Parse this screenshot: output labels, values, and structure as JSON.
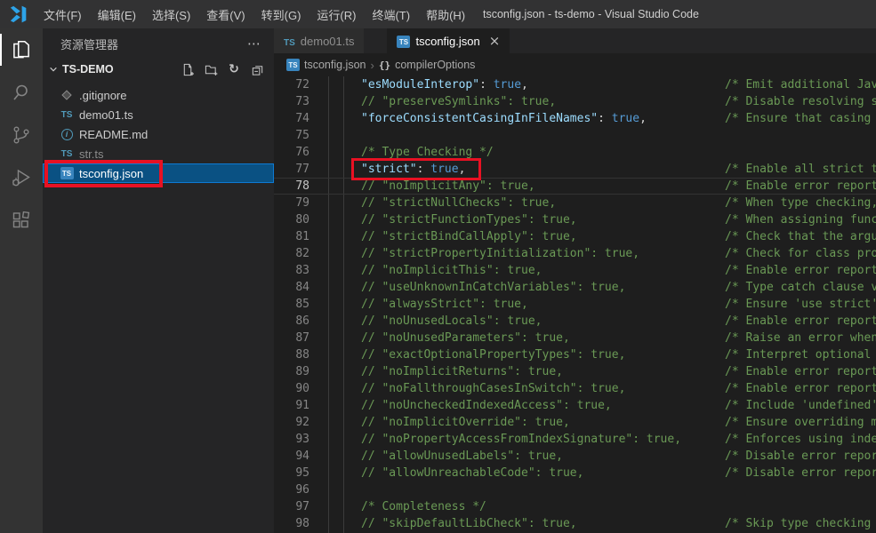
{
  "window_title": "tsconfig.json - ts-demo - Visual Studio Code",
  "menu_items": [
    "文件(F)",
    "编辑(E)",
    "选择(S)",
    "查看(V)",
    "转到(G)",
    "运行(R)",
    "终端(T)",
    "帮助(H)"
  ],
  "activity_bar": [
    {
      "id": "explorer",
      "active": true
    },
    {
      "id": "search",
      "active": false
    },
    {
      "id": "source-control",
      "active": false
    },
    {
      "id": "run-debug",
      "active": false
    },
    {
      "id": "extensions",
      "active": false
    }
  ],
  "sidebar": {
    "title": "资源管理器",
    "folder": "TS-DEMO",
    "actions": [
      "new-file",
      "new-folder",
      "refresh",
      "collapse-all"
    ],
    "files": [
      {
        "name": ".gitignore",
        "icon": "gitignore-icon",
        "dimmed": false,
        "selected": false,
        "annotated": false
      },
      {
        "name": "demo01.ts",
        "icon": "ts-icon",
        "dimmed": false,
        "selected": false,
        "annotated": false
      },
      {
        "name": "README.md",
        "icon": "info-icon",
        "dimmed": false,
        "selected": false,
        "annotated": false
      },
      {
        "name": "str.ts",
        "icon": "ts-icon",
        "dimmed": true,
        "selected": false,
        "annotated": false
      },
      {
        "name": "tsconfig.json",
        "icon": "ts-badge-icon",
        "dimmed": false,
        "selected": true,
        "annotated": true
      }
    ]
  },
  "tabs": [
    {
      "label": "demo01.ts",
      "icon": "ts-icon",
      "active": false,
      "closable": false
    },
    {
      "label": "tsconfig.json",
      "icon": "ts-badge-icon",
      "active": true,
      "closable": true
    }
  ],
  "breadcrumb": [
    {
      "icon": "ts-badge-icon",
      "label": "tsconfig.json"
    },
    {
      "icon": "braces-icon",
      "label": "compilerOptions"
    }
  ],
  "editor": {
    "language": "json-with-comments",
    "lines": [
      {
        "n": 72,
        "tokens": [
          [
            "key",
            "\"esModuleInterop\""
          ],
          [
            "punc",
            ": "
          ],
          [
            "bool",
            "true"
          ],
          [
            "punc",
            ","
          ]
        ],
        "comment": "/* Emit additional JavaScript to ease support for importing CommonJS modules. This enables 'allowSyntheticDefaultImports' for type compatibility. */",
        "annotated": false,
        "current": false
      },
      {
        "n": 73,
        "tokens": [
          [
            "comment",
            "// \"preserveSymlinks\": true,"
          ]
        ],
        "comment": "/* Disable resolving symlinks to their realpath. This correlates to the same flag in node. */",
        "annotated": false,
        "current": false
      },
      {
        "n": 74,
        "tokens": [
          [
            "key",
            "\"forceConsistentCasingInFileNames\""
          ],
          [
            "punc",
            ": "
          ],
          [
            "bool",
            "true"
          ],
          [
            "punc",
            ","
          ]
        ],
        "comment": "/* Ensure that casing is correct in imports. */",
        "annotated": false,
        "current": false
      },
      {
        "n": 75,
        "tokens": [],
        "comment": "",
        "annotated": false,
        "current": false
      },
      {
        "n": 76,
        "tokens": [
          [
            "comment",
            "/* Type Checking */"
          ]
        ],
        "comment": "",
        "annotated": false,
        "current": false
      },
      {
        "n": 77,
        "tokens": [
          [
            "key",
            "\"strict\""
          ],
          [
            "punc",
            ": "
          ],
          [
            "bool",
            "true"
          ],
          [
            "punc",
            ","
          ]
        ],
        "comment": "/* Enable all strict type-checking options. */",
        "annotated": true,
        "current": false
      },
      {
        "n": 78,
        "tokens": [
          [
            "comment",
            "// \"noImplicitAny\": true,"
          ]
        ],
        "comment": "/* Enable error reporting for expressions and declarations with an implied 'any' type. */",
        "annotated": false,
        "current": true
      },
      {
        "n": 79,
        "tokens": [
          [
            "comment",
            "// \"strictNullChecks\": true,"
          ]
        ],
        "comment": "/* When type checking, take into account 'null' and 'undefined'. */",
        "annotated": false,
        "current": false
      },
      {
        "n": 80,
        "tokens": [
          [
            "comment",
            "// \"strictFunctionTypes\": true,"
          ]
        ],
        "comment": "/* When assigning functions, check to ensure parameters and the return values are subtype-compatible. */",
        "annotated": false,
        "current": false
      },
      {
        "n": 81,
        "tokens": [
          [
            "comment",
            "// \"strictBindCallApply\": true,"
          ]
        ],
        "comment": "/* Check that the arguments for 'bind', 'call', and 'apply' methods match the original function. */",
        "annotated": false,
        "current": false
      },
      {
        "n": 82,
        "tokens": [
          [
            "comment",
            "// \"strictPropertyInitialization\": true,"
          ]
        ],
        "comment": "/* Check for class properties that are declared but not set in the constructor. */",
        "annotated": false,
        "current": false
      },
      {
        "n": 83,
        "tokens": [
          [
            "comment",
            "// \"noImplicitThis\": true,"
          ]
        ],
        "comment": "/* Enable error reporting when 'this' is given the type 'any'. */",
        "annotated": false,
        "current": false
      },
      {
        "n": 84,
        "tokens": [
          [
            "comment",
            "// \"useUnknownInCatchVariables\": true,"
          ]
        ],
        "comment": "/* Type catch clause variables as 'unknown' instead of 'any'. */",
        "annotated": false,
        "current": false
      },
      {
        "n": 85,
        "tokens": [
          [
            "comment",
            "// \"alwaysStrict\": true,"
          ]
        ],
        "comment": "/* Ensure 'use strict' is always emitted. */",
        "annotated": false,
        "current": false
      },
      {
        "n": 86,
        "tokens": [
          [
            "comment",
            "// \"noUnusedLocals\": true,"
          ]
        ],
        "comment": "/* Enable error reporting when a local variables aren't read. */",
        "annotated": false,
        "current": false
      },
      {
        "n": 87,
        "tokens": [
          [
            "comment",
            "// \"noUnusedParameters\": true,"
          ]
        ],
        "comment": "/* Raise an error when a function parameter isn't read. */",
        "annotated": false,
        "current": false
      },
      {
        "n": 88,
        "tokens": [
          [
            "comment",
            "// \"exactOptionalPropertyTypes\": true,"
          ]
        ],
        "comment": "/* Interpret optional property types as written, rather than adding 'undefined'. */",
        "annotated": false,
        "current": false
      },
      {
        "n": 89,
        "tokens": [
          [
            "comment",
            "// \"noImplicitReturns\": true,"
          ]
        ],
        "comment": "/* Enable error reporting for codepaths that do not explicitly return in a function. */",
        "annotated": false,
        "current": false
      },
      {
        "n": 90,
        "tokens": [
          [
            "comment",
            "// \"noFallthroughCasesInSwitch\": true,"
          ]
        ],
        "comment": "/* Enable error reporting for fallthrough cases in switch statements. */",
        "annotated": false,
        "current": false
      },
      {
        "n": 91,
        "tokens": [
          [
            "comment",
            "// \"noUncheckedIndexedAccess\": true,"
          ]
        ],
        "comment": "/* Include 'undefined' in index signature results */",
        "annotated": false,
        "current": false
      },
      {
        "n": 92,
        "tokens": [
          [
            "comment",
            "// \"noImplicitOverride\": true,"
          ]
        ],
        "comment": "/* Ensure overriding members in derived classes are marked with an override modifier. */",
        "annotated": false,
        "current": false
      },
      {
        "n": 93,
        "tokens": [
          [
            "comment",
            "// \"noPropertyAccessFromIndexSignature\": true,"
          ]
        ],
        "comment": "/* Enforces using indexed accessors for keys declared using an indexed type */",
        "annotated": false,
        "current": false
      },
      {
        "n": 94,
        "tokens": [
          [
            "comment",
            "// \"allowUnusedLabels\": true,"
          ]
        ],
        "comment": "/* Disable error reporting for unused labels. */",
        "annotated": false,
        "current": false
      },
      {
        "n": 95,
        "tokens": [
          [
            "comment",
            "// \"allowUnreachableCode\": true,"
          ]
        ],
        "comment": "/* Disable error reporting for unreachable code. */",
        "annotated": false,
        "current": false
      },
      {
        "n": 96,
        "tokens": [],
        "comment": "",
        "annotated": false,
        "current": false
      },
      {
        "n": 97,
        "tokens": [
          [
            "comment",
            "/* Completeness */"
          ]
        ],
        "comment": "",
        "annotated": false,
        "current": false
      },
      {
        "n": 98,
        "tokens": [
          [
            "comment",
            "// \"skipDefaultLibCheck\": true,"
          ]
        ],
        "comment": "/* Skip type checking .d.ts files that are included with TypeScript. */",
        "annotated": false,
        "current": false
      }
    ]
  },
  "colors": {
    "annotation_red": "#e81123",
    "accent_blue": "#0e7ad3",
    "selection_bg": "#0a5183",
    "comment_green": "#6a9955",
    "key_blue": "#9cdcfe",
    "bool_blue": "#569cd6",
    "ts_icon_blue": "#519aba",
    "titlebar_bg": "#323233",
    "sidebar_bg": "#252526",
    "editor_bg": "#1e1e1e"
  }
}
